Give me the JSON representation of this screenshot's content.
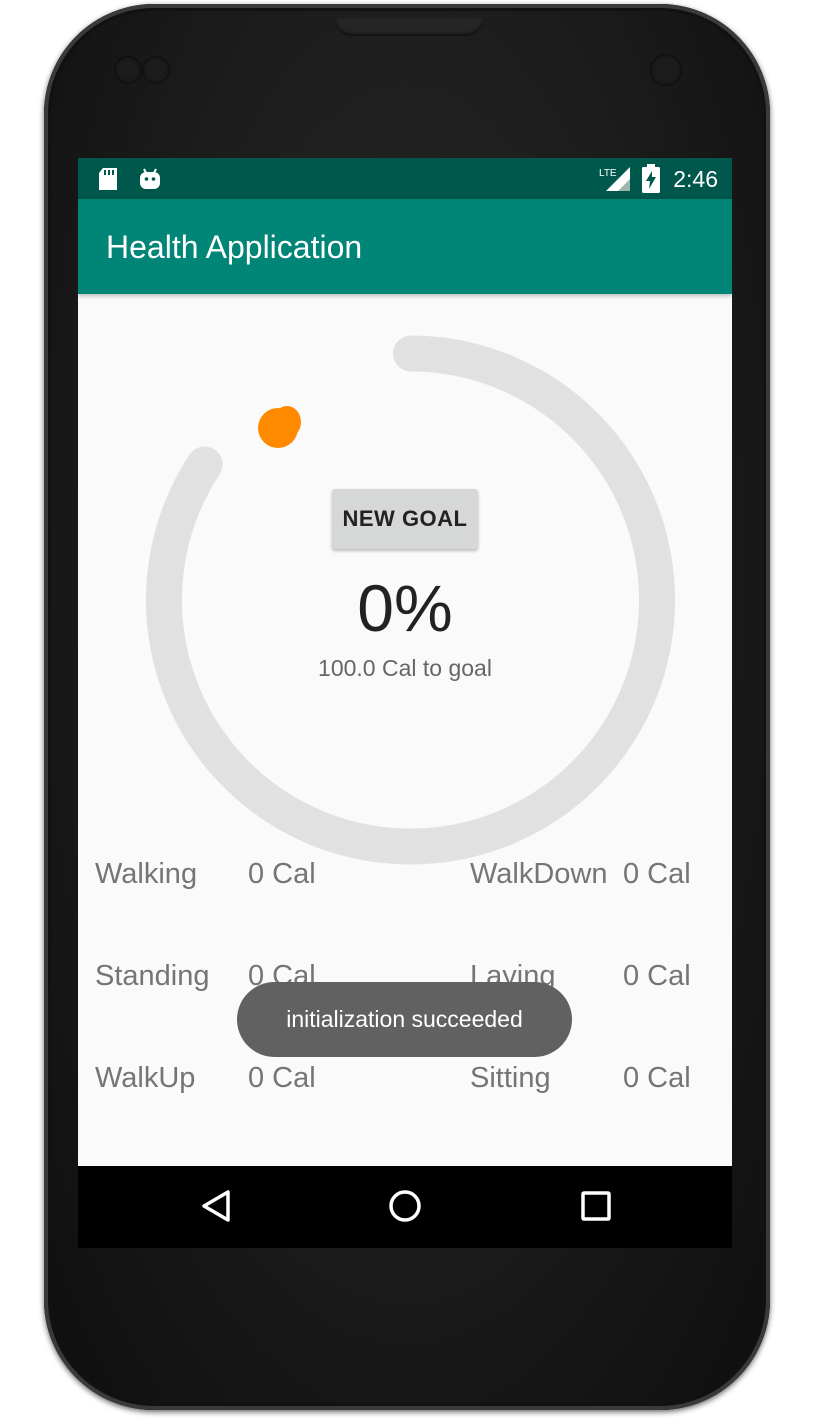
{
  "status_bar": {
    "time": "2:46",
    "network_label": "LTE",
    "icons": [
      "sd-card-icon",
      "android-debug-icon",
      "signal-icon",
      "battery-charging-icon"
    ]
  },
  "app_bar": {
    "title": "Health Application"
  },
  "progress": {
    "percent_label": "0%",
    "remaining_label": "100.0 Cal to goal",
    "progress_fraction": 0.0,
    "track_color": "#e1e1e1",
    "indicator_color": "#ff8a00"
  },
  "goal_button": {
    "label": "NEW GOAL"
  },
  "activities": [
    {
      "name": "Walking",
      "value": "0 Cal"
    },
    {
      "name": "WalkDown",
      "value": "0 Cal"
    },
    {
      "name": "Standing",
      "value": "0 Cal"
    },
    {
      "name": "Laying",
      "value": "0 Cal"
    },
    {
      "name": "WalkUp",
      "value": "0 Cal"
    },
    {
      "name": "Sitting",
      "value": "0 Cal"
    }
  ],
  "toast": {
    "message": "initialization succeeded"
  },
  "nav_bar": {
    "icons": [
      "back-icon",
      "home-icon",
      "recents-icon"
    ]
  },
  "colors": {
    "status_bar": "#00574b",
    "app_bar": "#008577",
    "background": "#fafafa"
  }
}
